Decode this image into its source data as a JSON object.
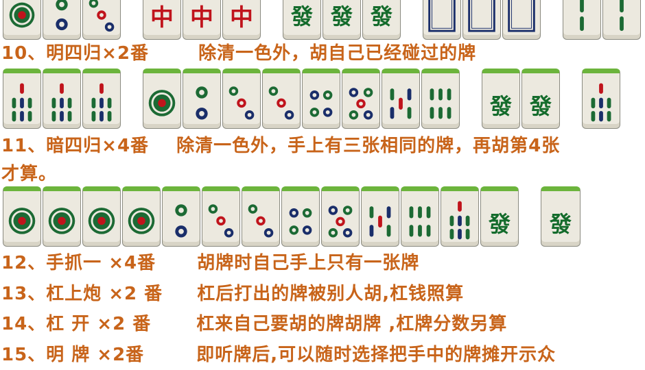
{
  "tiles": {
    "fa": "發",
    "zhong": "中"
  },
  "rules": [
    {
      "num": "10、明四归×2番",
      "desc": "除清一色外，胡自己已经碰过的牌"
    },
    {
      "num": "11、暗四归×4番",
      "desc": "除清一色外，手上有三张相同的牌，再胡第4张"
    },
    {
      "num": "才算。",
      "desc": ""
    },
    {
      "num": "12、手抓一 ×4番",
      "desc": "胡牌时自己手上只有一张牌"
    },
    {
      "num": "13、杠上炮 ×2 番",
      "desc": "杠后打出的牌被别人胡,杠钱照算"
    },
    {
      "num": "14、杠 开 ×2 番",
      "desc": "杠来自己要胡的牌胡牌 ,杠牌分数另算"
    },
    {
      "num": "15、明 牌 ×2番",
      "desc": "即听牌后,可以随时选择把手中的牌摊开示众"
    }
  ],
  "colors": {
    "text": "#c8641a",
    "tile_green": "#6cb43c",
    "fa": "#136b2b",
    "zhong": "#c0141c"
  }
}
